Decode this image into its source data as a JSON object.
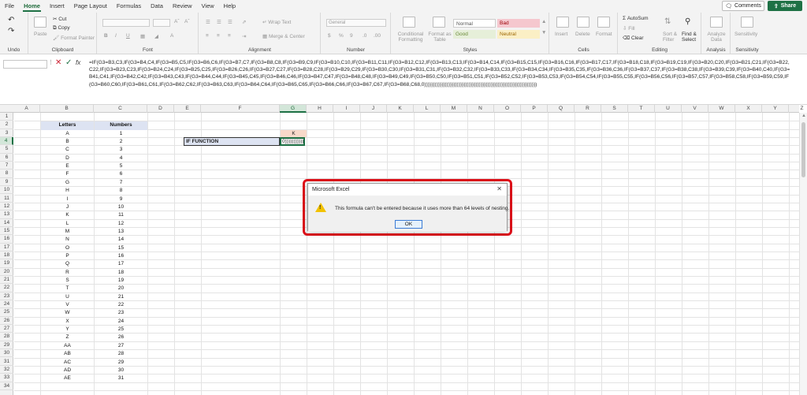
{
  "menu": {
    "tabs": [
      "File",
      "Home",
      "Insert",
      "Page Layout",
      "Formulas",
      "Data",
      "Review",
      "View",
      "Help"
    ],
    "active_tab": "Home",
    "comments_label": "Comments",
    "share_label": "Share"
  },
  "ribbon": {
    "undo": {
      "label": "Undo"
    },
    "clipboard": {
      "label": "Clipboard",
      "paste": "Paste",
      "cut": "Cut",
      "copy": "Copy",
      "format_painter": "Format Painter"
    },
    "font": {
      "label": "Font",
      "bold": "B",
      "italic": "I",
      "underline": "U"
    },
    "alignment": {
      "label": "Alignment",
      "wrap_text": "Wrap Text",
      "merge_center": "Merge & Center"
    },
    "number": {
      "label": "Number",
      "format": "General"
    },
    "styles": {
      "label": "Styles",
      "conditional": "Conditional Formatting",
      "format_as_table": "Format as Table",
      "normal": "Normal",
      "bad": "Bad",
      "good": "Good",
      "neutral": "Neutral"
    },
    "cells": {
      "label": "Cells",
      "insert": "Insert",
      "delete": "Delete",
      "format": "Format"
    },
    "editing": {
      "label": "Editing",
      "autosum": "AutoSum",
      "fill": "Fill",
      "clear": "Clear",
      "sort_filter": "Sort & Filter",
      "find_select": "Find & Select"
    },
    "analysis": {
      "label": "Analysis",
      "analyze_data": "Analyze Data"
    },
    "sensitivity": {
      "label": "Sensitivity",
      "sensitivity": "Sensitivity"
    }
  },
  "formula_bar": {
    "fx": "fx",
    "formula": "=IF(G3=B3,C3,IF(G3=B4,C4,IF(G3=B5,C5,IF(G3=B6,C6,IF(G3=B7,C7,IF(G3=B8,C8,IF(G3=B9,C9,IF(G3=B10,C10,IF(G3=B11,C11,IF(G3=B12,C12,IF(G3=B13,C13,IF(G3=B14,C14,IF(G3=B15,C15,IF(G3=B16,C16,IF(G3=B17,C17,IF(G3=B18,C18,IF(G3=B19,C19,IF(G3=B20,C20,IF(G3=B21,C21,IF(G3=B22,C22,IF(G3=B23,C23,IF(G3=B24,C24,IF(G3=B25,C25,IF(G3=B26,C26,IF(G3=B27,C27,IF(G3=B28,C28,IF(G3=B29,C29,IF(G3=B30,C30,IF(G3=B31,C31,IF(G3=B32,C32,IF(G3=B33,C33,IF(G3=B34,C34,IF(G3=B35,C35,IF(G3=B36,C36,IF(G3=B37,C37,IF(G3=B38,C38,IF(G3=B39,C39,IF(G3=B40,C40,IF(G3=B41,C41,IF(G3=B42,C42,IF(G3=B43,C43,IF(G3=B44,C44,IF(G3=B45,C45,IF(G3=B46,C46,IF(G3=B47,C47,IF(G3=B48,C48,IF(G3=B49,C49,IF(G3=B50,C50,IF(G3=B51,C51,IF(G3=B52,C52,IF(G3=B53,C53,IF(G3=B54,C54,IF(G3=B55,C55,IF(G3=B56,C56,IF(G3=B57,C57,IF(G3=B58,C58,IF(G3=B59,C59,IF(G3=B60,C60,IF(G3=B61,C61,IF(G3=B62,C62,IF(G3=B63,C63,IF(G3=B64,C64,IF(G3=B65,C65,IF(G3=B66,C66,IF(G3=B67,C67,IF(G3=B68,C68,0))))))))))))))))))))))))))))))))))))))))))))))))))))))))))))))))))"
  },
  "grid": {
    "columns": [
      "A",
      "B",
      "C",
      "D",
      "E",
      "F",
      "G",
      "H",
      "I",
      "J",
      "K",
      "L",
      "M",
      "N",
      "O",
      "P",
      "Q",
      "R",
      "S",
      "T",
      "U",
      "V",
      "W",
      "X",
      "Y",
      "Z"
    ],
    "selected_column": "G",
    "selected_row": "4",
    "header_letters": "Letters",
    "header_numbers": "Numbers",
    "letters": [
      "A",
      "B",
      "C",
      "D",
      "E",
      "F",
      "G",
      "H",
      "I",
      "J",
      "K",
      "L",
      "M",
      "N",
      "O",
      "P",
      "Q",
      "R",
      "S",
      "T",
      "U",
      "V",
      "W",
      "X",
      "Y",
      "Z",
      "AA",
      "AB",
      "AC",
      "AD",
      "AE"
    ],
    "numbers": [
      "1",
      "2",
      "3",
      "4",
      "5",
      "6",
      "7",
      "8",
      "9",
      "10",
      "11",
      "12",
      "13",
      "14",
      "15",
      "16",
      "17",
      "18",
      "19",
      "20",
      "21",
      "22",
      "23",
      "24",
      "25",
      "26",
      "27",
      "28",
      "29",
      "30",
      "31"
    ],
    "lookup_value": "K",
    "if_label": "IF FUNCTION",
    "active_cell_text": "0)))))))))))"
  },
  "dialog": {
    "title": "Microsoft Excel",
    "message": "This formula can't be entered because it uses more than 64 levels of nesting.",
    "ok_label": "OK"
  },
  "colors": {
    "accent": "#1e7145",
    "highlight_border": "#e0101a",
    "header_fill": "#dde3f2",
    "lookup_fill": "#f8d9c9"
  }
}
